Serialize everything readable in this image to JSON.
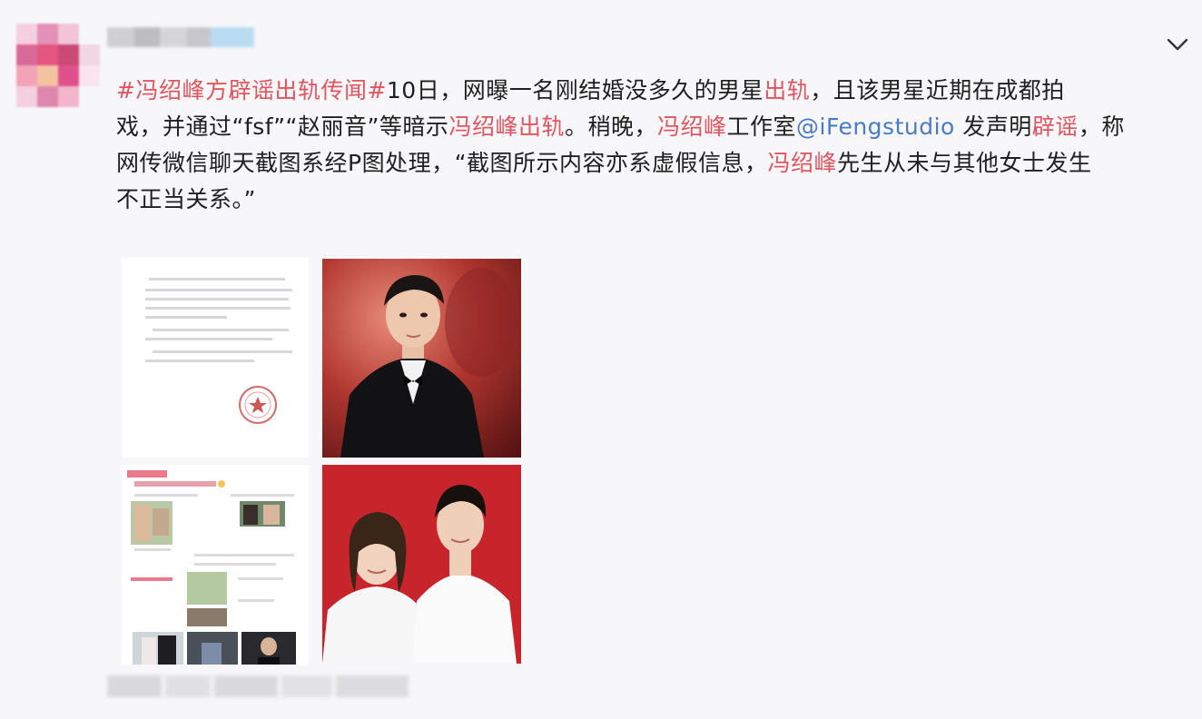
{
  "post": {
    "hashtag": "#冯绍峰方辟谣出轨传闻#",
    "line1_a": "10日，网曝一名刚结婚没多久的男星",
    "line1_hl": "出轨",
    "line1_b": "，且该男星近期在成都拍",
    "line2_a": "戏，并通过“fsf”“赵丽音”等暗示",
    "line2_hl1": "冯绍峰出轨",
    "line2_b": "。稍晚，",
    "line2_hl2": "冯绍峰",
    "line2_c": "工作室",
    "line2_mention": "@iFengstudio",
    "line2_d": " 发声明",
    "line2_hl3": "辟谣",
    "line2_e": "，称",
    "line3_a": "网传微信聊天截图系经P图处理，“截图所示内容亦系虚假信息，",
    "line3_hl": "冯绍峰",
    "line3_b": "先生从未与其他女士发生",
    "line4": "不正当关系。”"
  },
  "images": [
    {
      "name": "statement-document-image"
    },
    {
      "name": "portrait-photo-image"
    },
    {
      "name": "chat-screenshot-image"
    },
    {
      "name": "couple-photo-image"
    }
  ],
  "colors": {
    "highlight": "#e0555f",
    "mention": "#4a7bc8",
    "text": "#1f1f1f"
  },
  "icons": {
    "menu": "chevron-down-icon",
    "seal": "seal-stamp-icon"
  }
}
